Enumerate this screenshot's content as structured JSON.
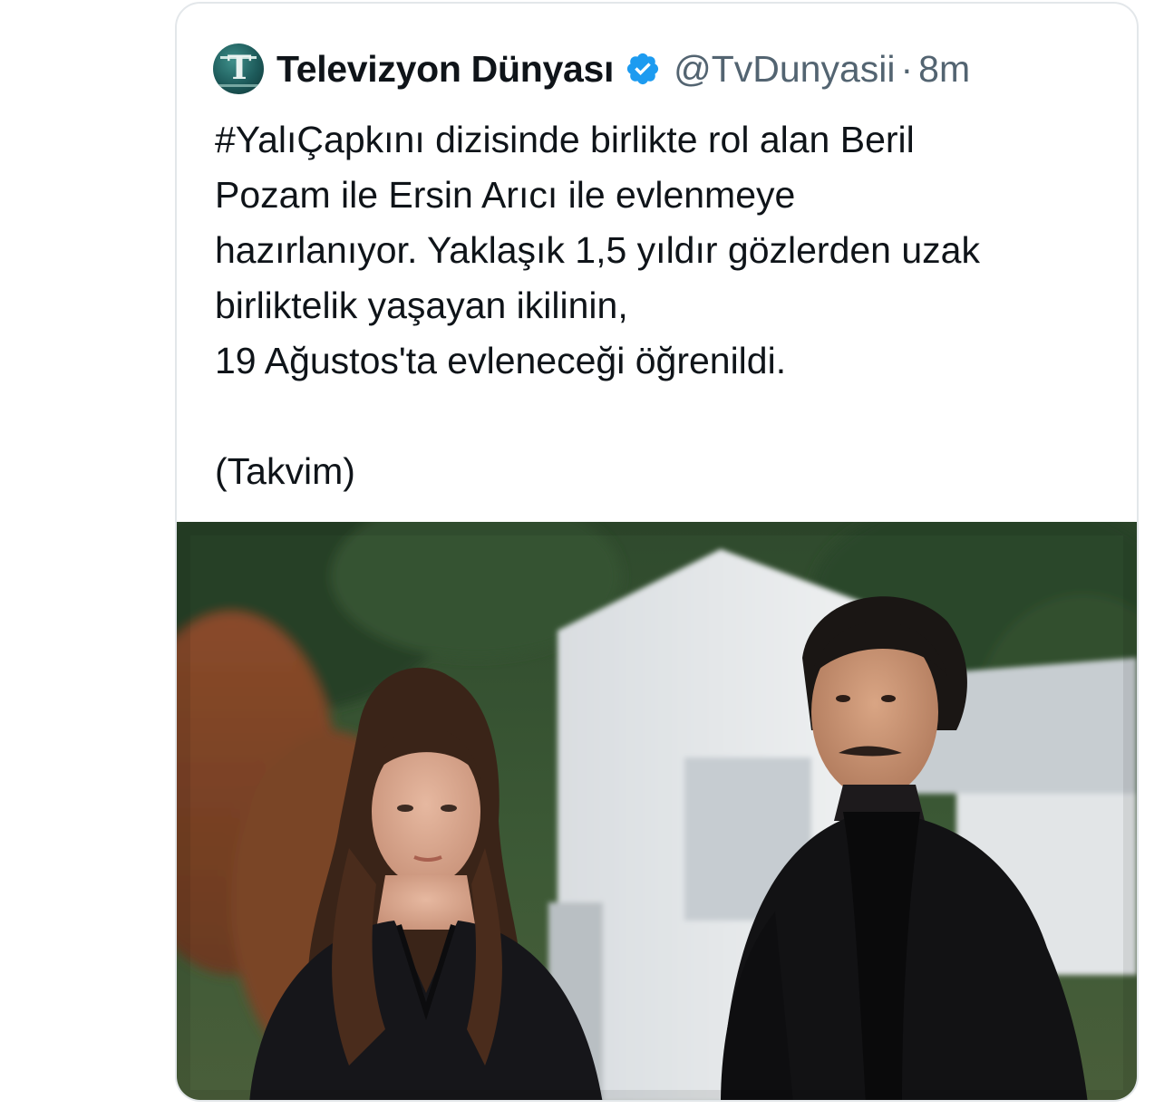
{
  "tweet": {
    "author": {
      "avatar_icon": "televizyon-dunyasi-logo",
      "display_name": "Televizyon Dünyası",
      "verified_icon": "verified-badge-icon",
      "handle": "@TvDunyasii",
      "separator": "·",
      "timestamp": "8m"
    },
    "text_lines": [
      "#YalıÇapkını dizisinde birlikte rol alan Beril",
      "Pozam ile Ersin Arıcı ile evlenmeye",
      "hazırlanıyor. Yaklaşık 1,5 yıldır gözlerden uzak",
      "birliktelik yaşayan ikilinin,",
      "19 Ağustos'ta evleneceği öğrenildi."
    ],
    "source_line": "(Takvim)",
    "media": {
      "type": "photo",
      "icon": "tweet-photo"
    }
  },
  "colors": {
    "text_primary": "#0f1419",
    "text_secondary": "#536471",
    "verified_blue": "#1d9bf0",
    "border": "#e3e7ea"
  }
}
